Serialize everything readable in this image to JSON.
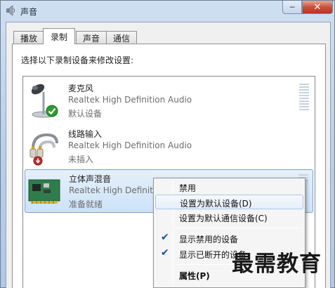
{
  "window": {
    "title": "声音"
  },
  "tabs": [
    {
      "label": "播放",
      "active": false
    },
    {
      "label": "录制",
      "active": true
    },
    {
      "label": "声音",
      "active": false
    },
    {
      "label": "通信",
      "active": false
    }
  ],
  "instruction": "选择以下录制设备来修改设置:",
  "devices": [
    {
      "name": "麦克风",
      "driver": "Realtek High Definition Audio",
      "status": "默认设备",
      "icon": "microphone-icon",
      "badge": "default-check"
    },
    {
      "name": "线路输入",
      "driver": "Realtek High Definition Audio",
      "status": "未插入",
      "icon": "line-in-cable-icon",
      "badge": "unplugged"
    },
    {
      "name": "立体声混音",
      "driver": "Realtek High Definition Audio",
      "status": "准备就绪",
      "icon": "sound-card-icon",
      "selected": true
    }
  ],
  "context_menu": {
    "items": [
      {
        "label": "禁用",
        "checked": false
      },
      {
        "label": "设置为默认设备(D)",
        "checked": false,
        "hover": true
      },
      {
        "label": "设置为默认通信设备(C)",
        "checked": false
      },
      {
        "label": "显示禁用的设备",
        "checked": true
      },
      {
        "label": "显示已断开的设备",
        "checked": true
      },
      {
        "label": "属性(P)",
        "checked": false,
        "bold": true
      }
    ]
  },
  "watermark": "最需教育",
  "colors": {
    "selection": "#cde2f7",
    "check": "#1b4fa8",
    "close": "#c7533c"
  }
}
